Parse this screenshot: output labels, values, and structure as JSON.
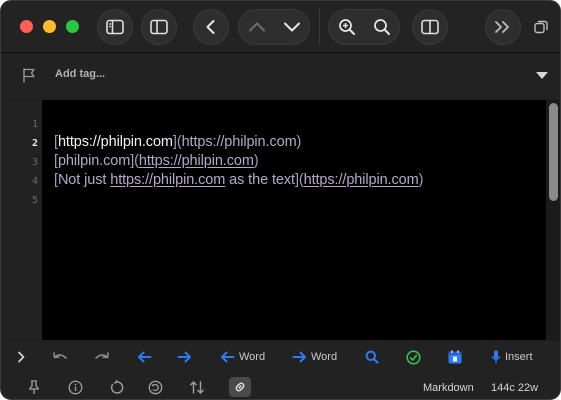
{
  "window": {
    "toolbar_icons": [
      "sidebar-icon",
      "inspector-icon",
      "back-icon",
      "previous-icon",
      "next-icon",
      "zoom-in-icon",
      "search-icon",
      "panel-icon",
      "expand-icon",
      "duplicate-icon"
    ]
  },
  "tagbar": {
    "placeholder": "Add tag..."
  },
  "editor": {
    "line_numbers": [
      "1",
      "2",
      "3",
      "4",
      "5"
    ],
    "current_line": "2",
    "lines": {
      "l2": {
        "open": "[",
        "text": "https://philpin.com",
        "mid": "]",
        "paren_open": "(",
        "url": "https://philpin.com",
        "paren_close": ")"
      },
      "l3": {
        "open": "[",
        "text": "philpin.com",
        "mid": "]",
        "paren_open": "(",
        "url": "https://philpin.com",
        "paren_close": ")"
      },
      "l4": {
        "open": "[",
        "prefix": "Not just ",
        "link": "https://philpin.com",
        "suffix": " as the text",
        "mid": "]",
        "paren_open": "(",
        "url": "https://philpin.com",
        "paren_close": ")"
      }
    }
  },
  "keybar": {
    "word_left_label": "Word",
    "word_right_label": "Word",
    "insert_label": "Insert",
    "accent": "#2f7bf6",
    "check_color": "#34c759"
  },
  "statusbar": {
    "mode": "Markdown",
    "stats": "144c 22w"
  }
}
